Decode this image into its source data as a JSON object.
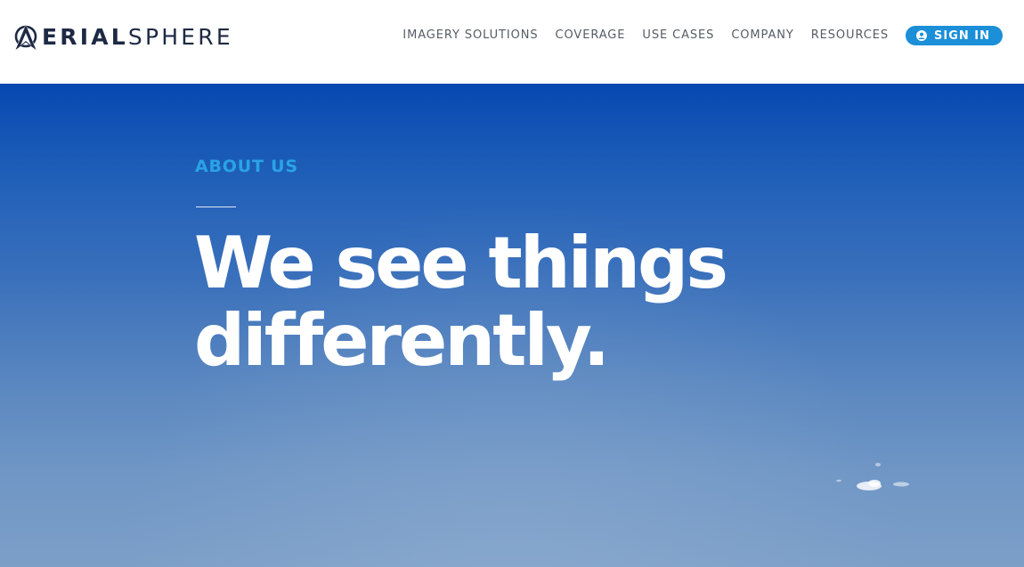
{
  "header": {
    "logo": {
      "text_bold": "ERIAL",
      "text_light": "SPHERE",
      "mark_icon": "aerialsphere-a-logo-mark"
    },
    "nav": [
      {
        "label": "IMAGERY SOLUTIONS"
      },
      {
        "label": "COVERAGE"
      },
      {
        "label": "USE CASES"
      },
      {
        "label": "COMPANY"
      },
      {
        "label": "RESOURCES"
      }
    ],
    "signin": {
      "label": "SIGN IN",
      "icon": "user-circle-icon"
    }
  },
  "hero": {
    "eyebrow": "ABOUT US",
    "headline_line1": "We see things",
    "headline_line2": "differently."
  },
  "colors": {
    "accent": "#1b8fd8",
    "eyebrow": "#2aa3e6",
    "logo_navy": "#1e2a44",
    "nav_text": "#555d66",
    "sky_top": "#0648b0",
    "sky_bottom": "#7c9fc8"
  }
}
